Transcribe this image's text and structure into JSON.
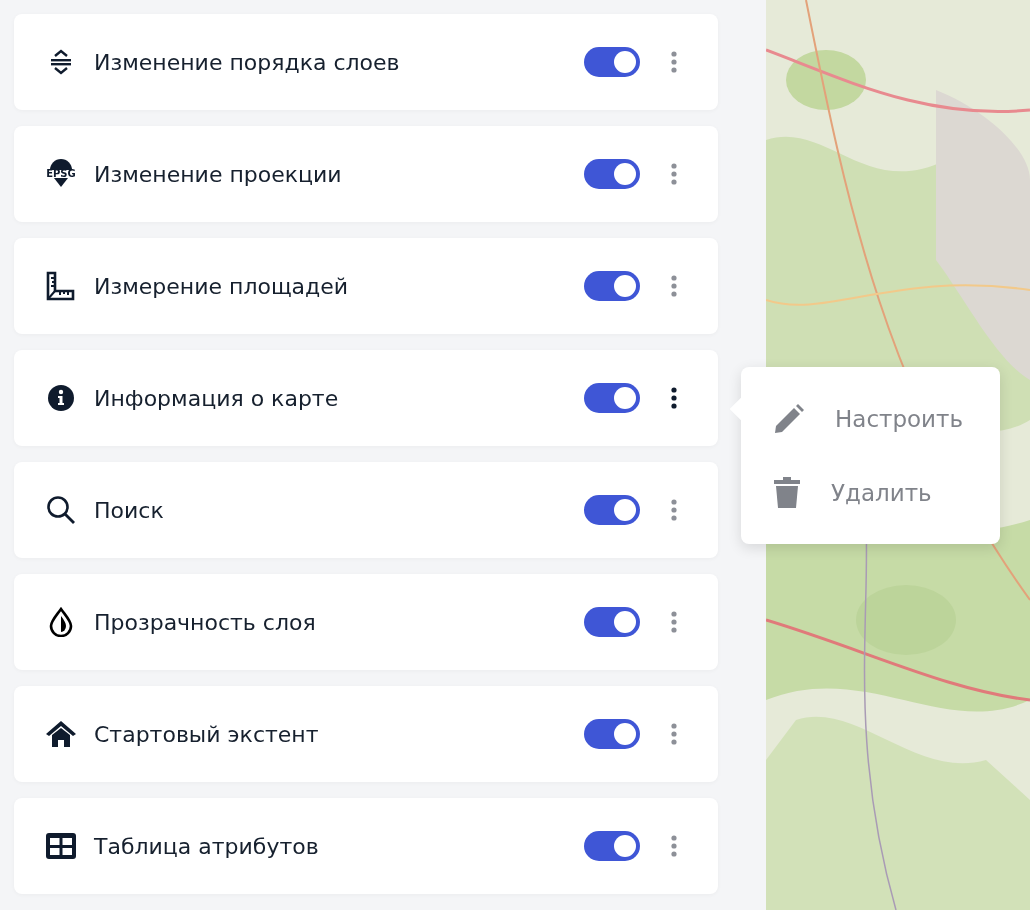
{
  "widgets": [
    {
      "label": "Изменение порядка слоев",
      "kind": "order",
      "on": true,
      "menu_open": false
    },
    {
      "label": "Изменение проекции",
      "kind": "epsg",
      "icon_label": "EPSG",
      "on": true,
      "menu_open": false
    },
    {
      "label": "Измерение площадей",
      "kind": "ruler",
      "on": true,
      "menu_open": false
    },
    {
      "label": "Информация о карте",
      "kind": "info",
      "on": true,
      "menu_open": true
    },
    {
      "label": "Поиск",
      "kind": "search",
      "on": true,
      "menu_open": false
    },
    {
      "label": "Прозрачность слоя",
      "kind": "drop",
      "on": true,
      "menu_open": false
    },
    {
      "label": "Стартовый экстент",
      "kind": "home",
      "on": true,
      "menu_open": false
    },
    {
      "label": "Таблица атрибутов",
      "kind": "table",
      "on": true,
      "menu_open": false
    }
  ],
  "menu": [
    {
      "label": "Настроить",
      "kind": "edit"
    },
    {
      "label": "Удалить",
      "kind": "delete"
    }
  ]
}
